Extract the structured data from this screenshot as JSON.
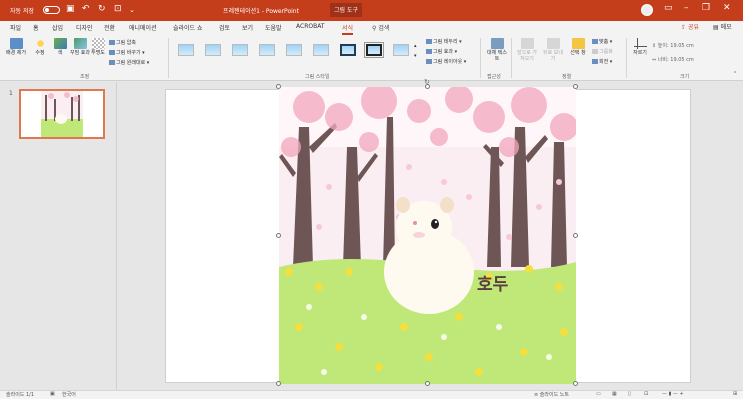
{
  "titlebar": {
    "autosave_label": "자동 저장",
    "doc_title": "프레젠테이션1 - PowerPoint",
    "context_tab": "그림 도구"
  },
  "tabs": [
    "파일",
    "홈",
    "삽입",
    "디자인",
    "전환",
    "애니메이션",
    "슬라이드 쇼",
    "검토",
    "보기",
    "도움말",
    "ACROBAT",
    "서식"
  ],
  "active_tab": "서식",
  "search_label": "검색",
  "share_label": "공유",
  "comment_label": "메모",
  "ribbon": {
    "adjust": {
      "remove_bg": "배경 제거",
      "corrections": "수정",
      "color": "색",
      "artistic": "꾸밈 효과",
      "transparency": "투명도",
      "compress": "그림 압축",
      "change": "그림 바꾸기",
      "reset": "그림 원래대로",
      "label": "조정"
    },
    "styles_label": "그림 스타일",
    "picture_border": "그림 테두리",
    "picture_effects": "그림 효과",
    "picture_layout": "그림 레이아웃",
    "alt_text": "대체 텍스트",
    "accessibility_label": "접근성",
    "arrange": {
      "forward": "앞으로 가져오기",
      "backward": "뒤로 보내기",
      "selection_pane": "선택 창",
      "align": "맞춤",
      "group": "그룹화",
      "rotate": "회전",
      "label": "정렬"
    },
    "crop": "자르기",
    "size": {
      "height": "높이: 19.05 cm",
      "width": "너비: 19.05 cm",
      "label": "크기"
    }
  },
  "slide_number": "1",
  "picture": {
    "caption": "호두"
  },
  "statusbar": {
    "slide_info": "슬라이드 1/1",
    "language": "한국어",
    "notes": "슬라이드 노트"
  },
  "colors": {
    "brand": "#c43e1c",
    "sky": "#fbeef3",
    "grass": "#bfe878",
    "blossom": "#f2a7bd",
    "trunk": "#6e5656"
  }
}
